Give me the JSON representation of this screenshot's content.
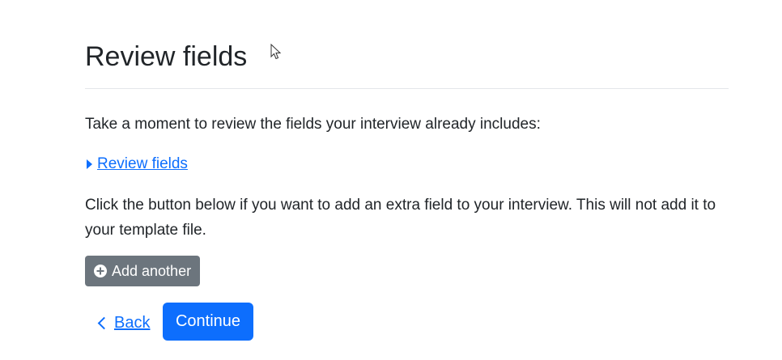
{
  "page": {
    "title": "Review fields",
    "intro": "Take a moment to review the fields your interview already includes:",
    "review_toggle_label": " Review fields",
    "explanation": "Click the button below if you want to add an extra field to your interview. This will not add it to your template file."
  },
  "buttons": {
    "add_another": "Add another",
    "back": "Back",
    "continue": "Continue"
  },
  "icons": {
    "add": "plus-circle-icon",
    "back": "chevron-left-icon",
    "toggle": "caret-right-icon",
    "cursor": "mouse-pointer-icon"
  },
  "colors": {
    "primary": "#0d6efd",
    "secondary": "#6c757d",
    "text": "#212529"
  }
}
